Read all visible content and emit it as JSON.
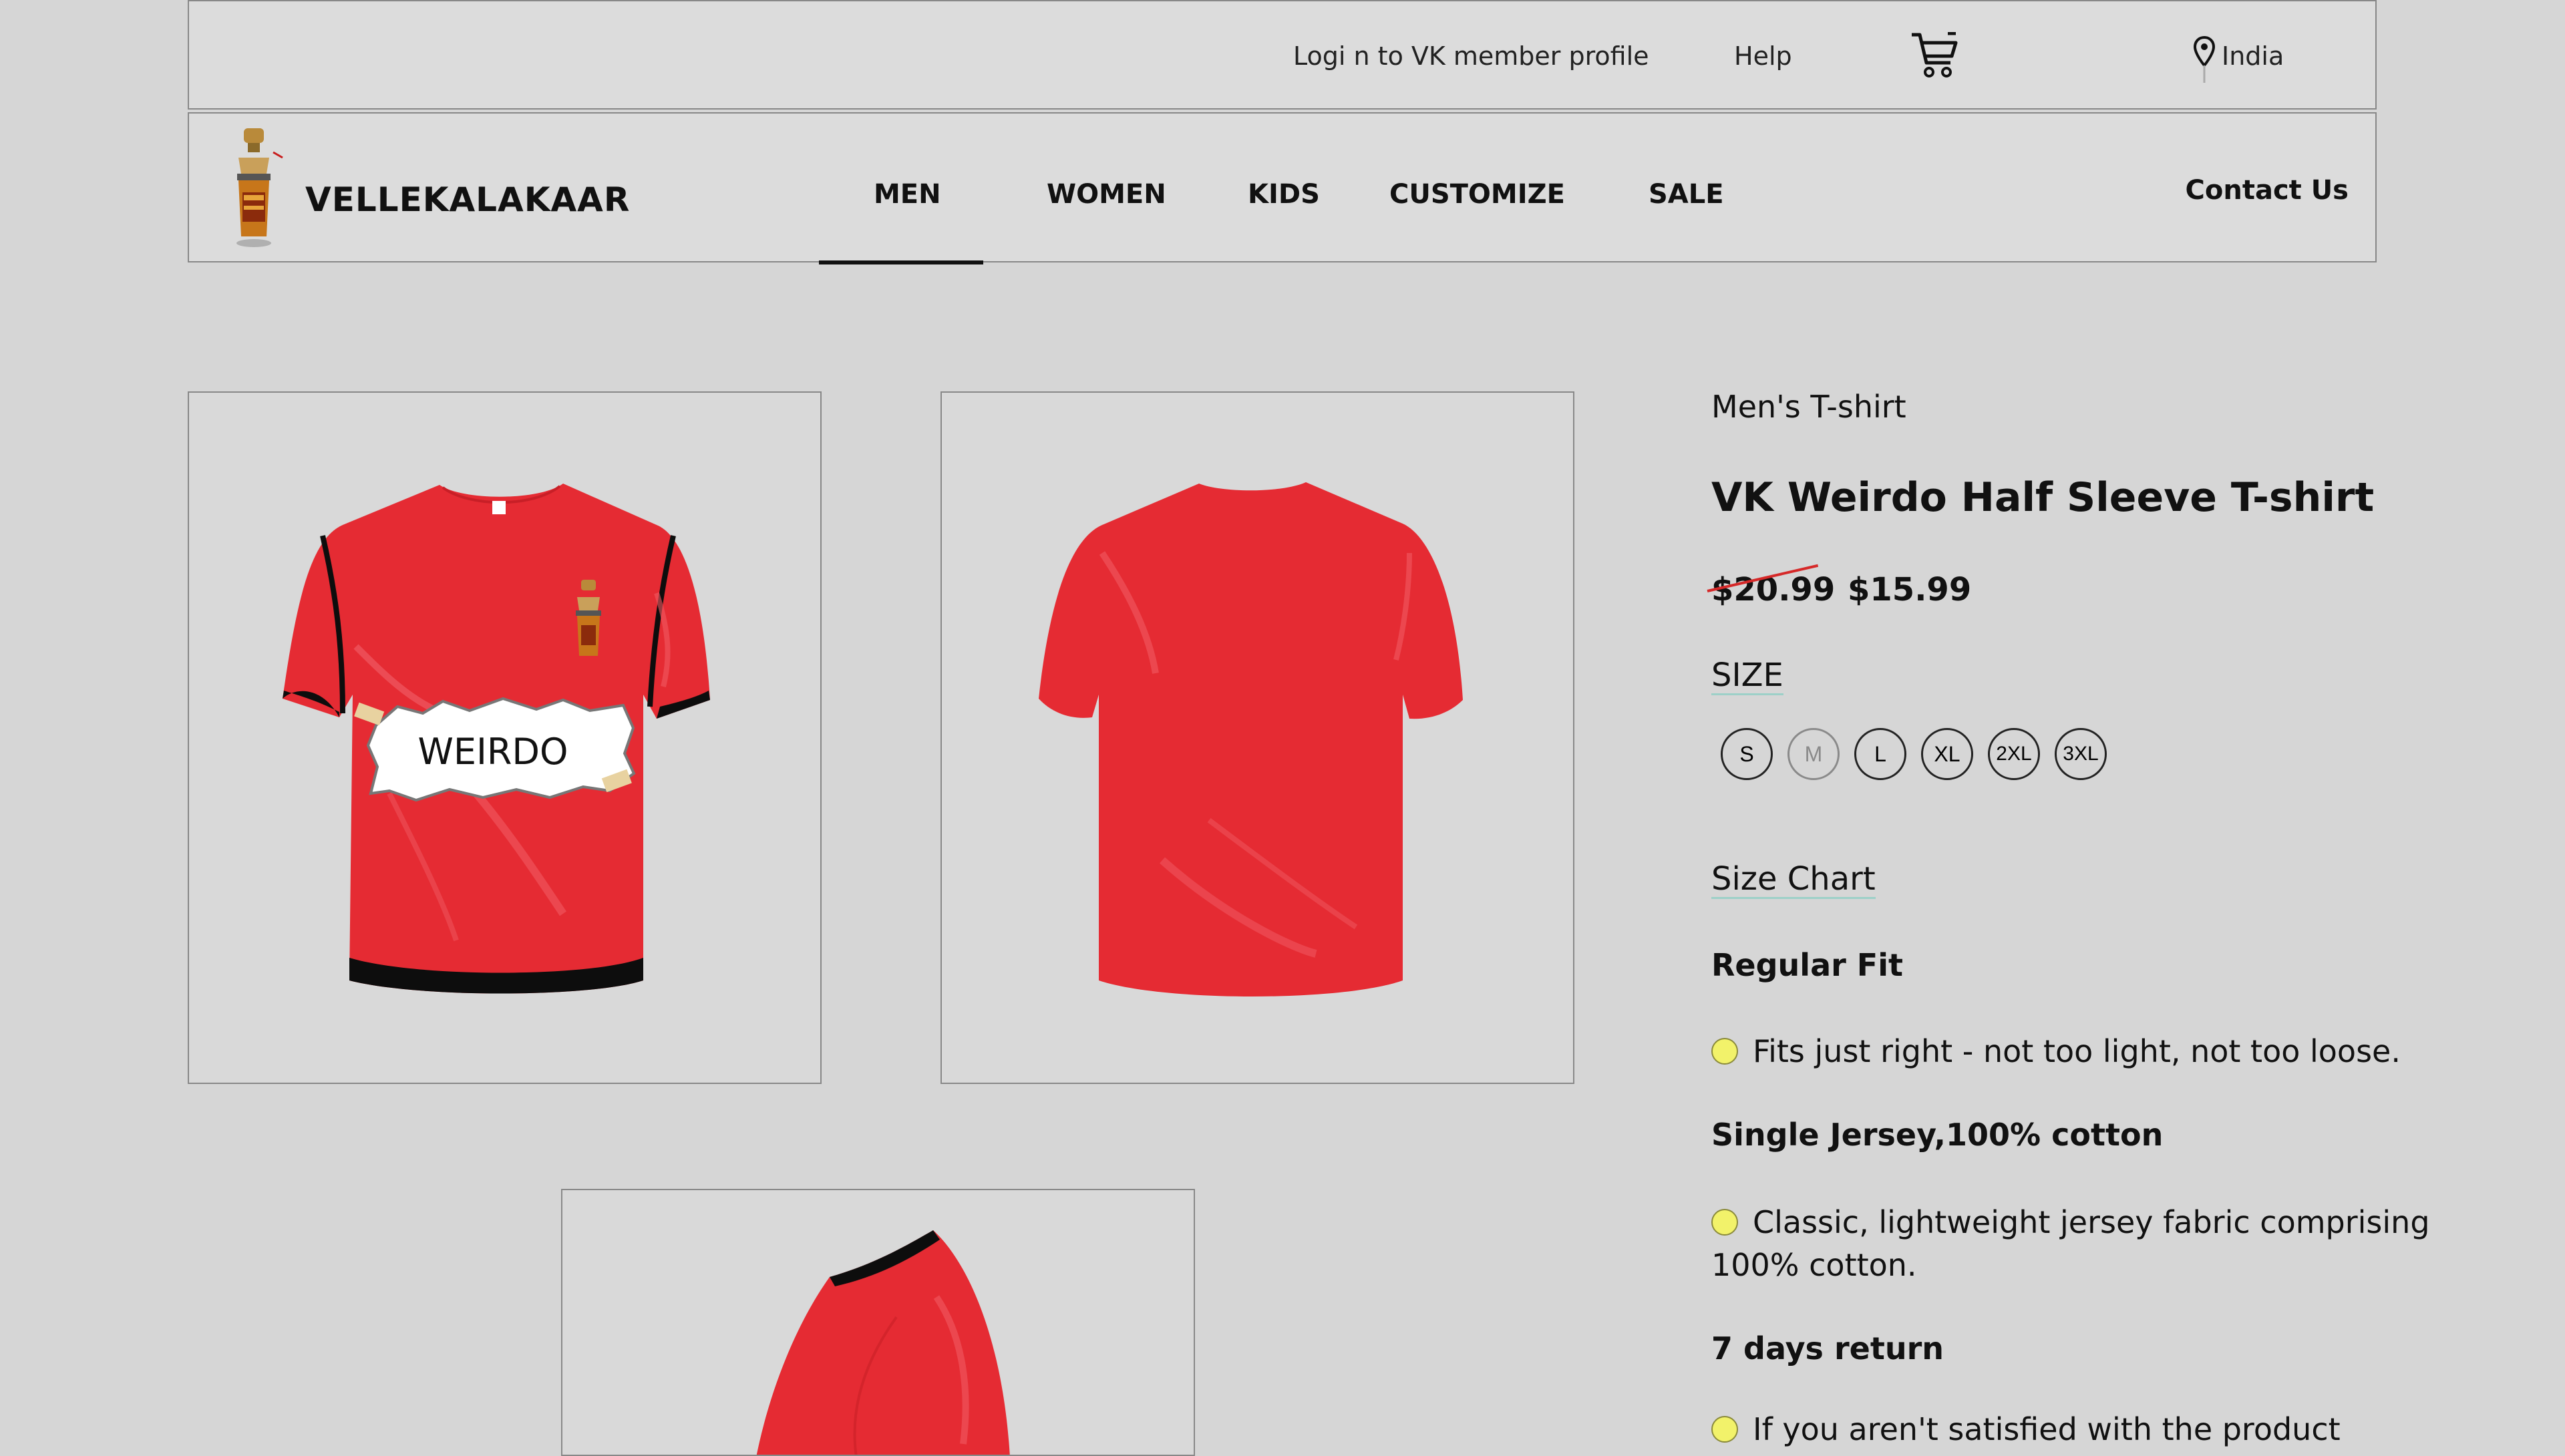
{
  "topbar": {
    "login_label": "Logi n to VK member profile",
    "help_label": "Help",
    "cart_icon": "cart-icon",
    "location_icon": "location-pin-icon",
    "location_label": "India"
  },
  "nav": {
    "brand": "VELLEKALAKAAR",
    "logo_icon": "cocktail-shaker-logo",
    "items": [
      {
        "label": "MEN",
        "active": true
      },
      {
        "label": "WOMEN"
      },
      {
        "label": "KIDS"
      },
      {
        "label": "CUSTOMIZE"
      },
      {
        "label": "SALE"
      }
    ],
    "contact_label": "Contact Us"
  },
  "product": {
    "category": "Men's T-shirt",
    "title": "VK Weirdo Half Sleeve T-shirt",
    "price_old": "$20.99",
    "price_new": "$15.99",
    "size_label": "SIZE",
    "sizes": [
      {
        "label": "S",
        "available": true
      },
      {
        "label": "M",
        "available": false
      },
      {
        "label": "L",
        "available": true
      },
      {
        "label": "XL",
        "available": true
      },
      {
        "label": "2XL",
        "available": true
      },
      {
        "label": "3XL",
        "available": true
      }
    ],
    "size_chart_label": "Size Chart",
    "front_print_text": "WEIRDO",
    "features": [
      {
        "heading": "Regular Fit",
        "text": "Fits just right - not too light, not too loose."
      },
      {
        "heading": "Single Jersey,100% cotton",
        "text": "Classic, lightweight jersey fabric comprising 100% cotton."
      },
      {
        "heading": "7 days return",
        "text": "If you aren't satisfied with the product"
      }
    ]
  },
  "colors": {
    "shirt_red": "#e52b33",
    "background": "#d6d6d6",
    "bullet_yellow": "#f2f26a"
  }
}
